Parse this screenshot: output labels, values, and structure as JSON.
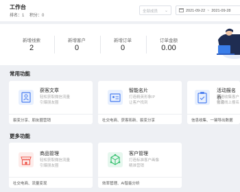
{
  "header": {
    "title": "工作台",
    "rank": "排名：1",
    "points": "积分：0",
    "select_placeholder": "全部成员",
    "date_start": "2021-09-22",
    "date_separator": "~",
    "date_end": "2021-09-28"
  },
  "stats": [
    {
      "label": "新增线索",
      "value": "2"
    },
    {
      "label": "新增客户",
      "value": "0"
    },
    {
      "label": "新增订单",
      "value": "0"
    },
    {
      "label": "订单金额",
      "value": "0.00"
    }
  ],
  "common": {
    "title": "常用功能",
    "cards": [
      {
        "name": "获客文章",
        "desc1": "轻松获取微信流量",
        "desc2": "引爆朋友圈",
        "tags": "裂变分享、朋友圈营销"
      },
      {
        "name": "智能名片",
        "desc1": "打造精英形象IP",
        "desc2": "让客户找到",
        "tags": "社交电商、获客拓新、裂变分享"
      },
      {
        "name": "活动报名表",
        "desc1": "快速收集客户信息",
        "desc2": "实现线上报名",
        "tags": "信息收集、一键导出数据"
      }
    ]
  },
  "more": {
    "title": "更多功能",
    "cards": [
      {
        "name": "商品管理",
        "desc1": "轻松获取微信流量",
        "desc2": "引爆朋友圈",
        "tags": "社交电商、流量变现"
      },
      {
        "name": "客户管理",
        "desc1": "打造标准客户画像",
        "desc2": "精准营销",
        "tags": "效率管理、AI智能分析"
      }
    ]
  },
  "colors": {
    "accent": "#3a7de8",
    "blue_icon": "#4a7ef0",
    "red_icon": "#ee5a4f",
    "green_icon": "#2fbf6a"
  }
}
